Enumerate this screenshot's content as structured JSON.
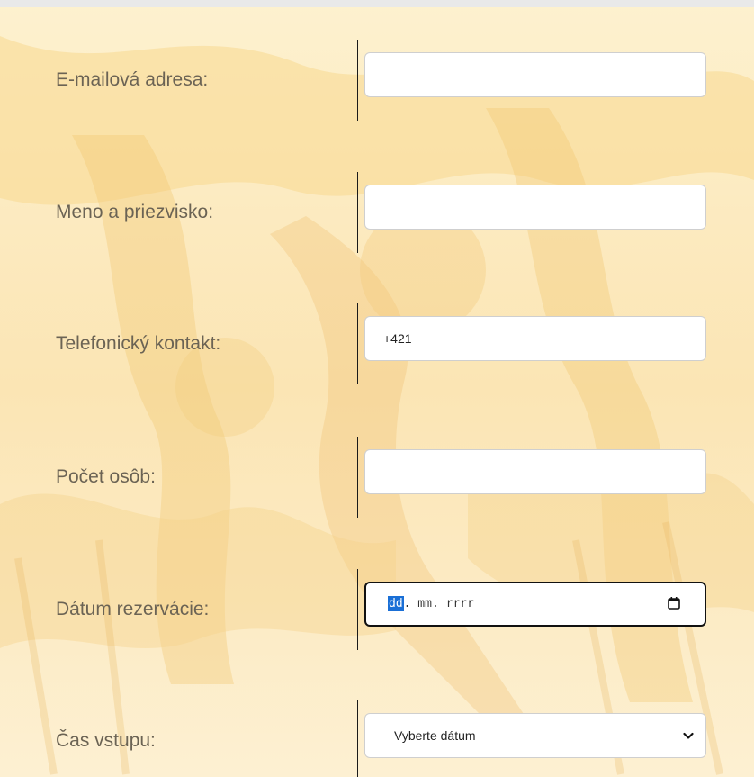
{
  "colors": {
    "label_text": "#6b6354",
    "divider": "#1a1a1a",
    "field_border": "#cfcfcf",
    "focus_border": "#111111",
    "date_highlight": "#1a6fd6",
    "topbar": "#e9e9e9"
  },
  "form": {
    "email": {
      "label": "E-mailová adresa:",
      "value": ""
    },
    "name": {
      "label": "Meno a priezvisko:",
      "value": ""
    },
    "phone": {
      "label": "Telefonický kontakt:",
      "value": "+421"
    },
    "persons": {
      "label": "Počet osôb:",
      "value": ""
    },
    "date": {
      "label": "Dátum rezervácie:",
      "placeholder_day": "dd",
      "placeholder_rest": ". mm. rrrr",
      "icon": "calendar-icon"
    },
    "time": {
      "label": "Čas vstupu:",
      "selected": "Vyberte dátum",
      "icon": "chevron-down-icon"
    }
  }
}
